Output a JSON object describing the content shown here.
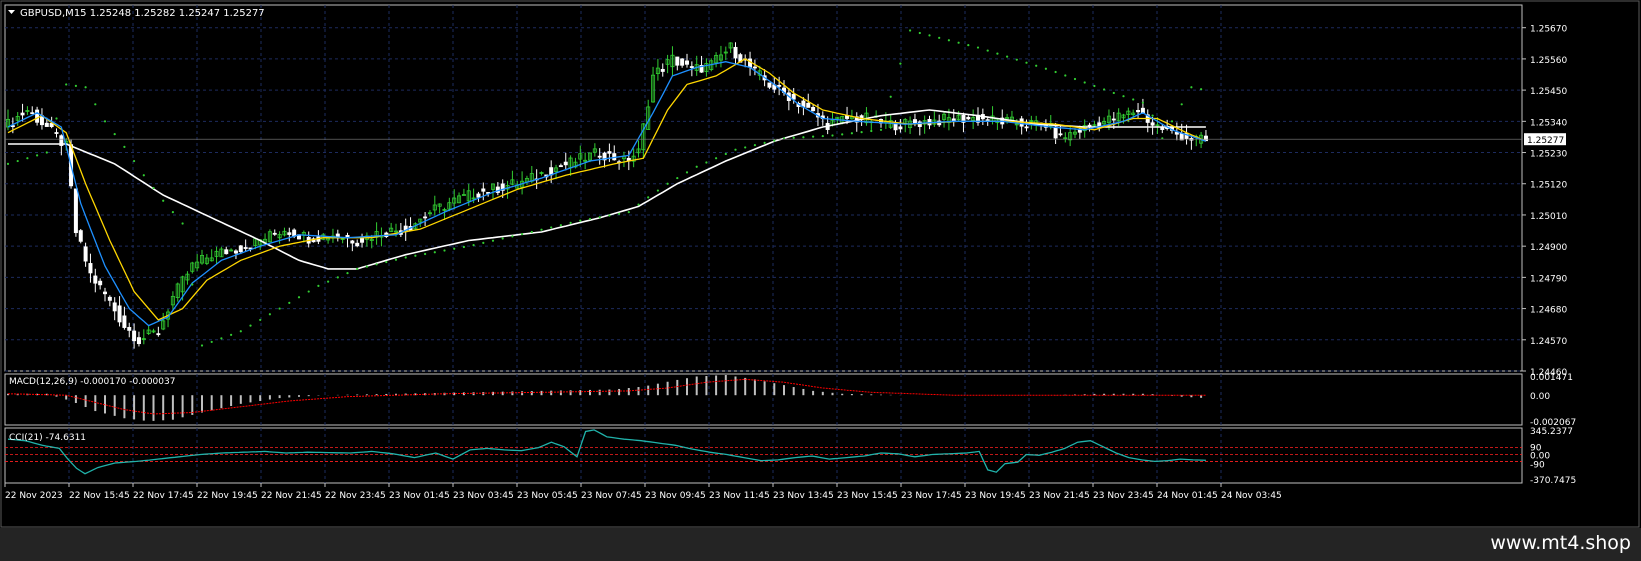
{
  "colors": {
    "background": "#000000",
    "grid": "#1d2b5e",
    "pane_border": "#c0c0c0",
    "text": "#ffffff",
    "bull_candle": "#32cd32",
    "bear_candle": "#ffffff",
    "ma_fast": "#1e90ff",
    "ma_mid": "#ffd700",
    "ma_slow": "#ffffff",
    "psar": "#32cd32",
    "macd_hist": "#c0c0c0",
    "macd_signal": "#ff0000",
    "cci_line": "#20b2aa",
    "cci_level": "#ff2020",
    "footer_bg": "#242424"
  },
  "header": {
    "symbol_info": "GBPUSD,M15  1.25248 1.25282 1.25247 1.25277"
  },
  "price_axis": {
    "ticks": [
      "1.25670",
      "1.25560",
      "1.25450",
      "1.25340",
      "1.25230",
      "1.25120",
      "1.25010",
      "1.24900",
      "1.24790",
      "1.24680",
      "1.24570",
      "1.24460"
    ],
    "current_price": "1.25277"
  },
  "macd": {
    "label": "MACD(12,26,9) -0.000170 -0.000037",
    "ticks": [
      "0.001471",
      "0.00",
      "-0.002067"
    ]
  },
  "cci": {
    "label": "CCI(21) -74.6311",
    "ticks": [
      "345.2377",
      "90",
      "0.00",
      "-90",
      "-370.7475"
    ]
  },
  "time_axis": [
    "22 Nov 2023",
    "22 Nov 15:45",
    "22 Nov 17:45",
    "22 Nov 19:45",
    "22 Nov 21:45",
    "22 Nov 23:45",
    "23 Nov 01:45",
    "23 Nov 03:45",
    "23 Nov 05:45",
    "23 Nov 07:45",
    "23 Nov 09:45",
    "23 Nov 11:45",
    "23 Nov 13:45",
    "23 Nov 15:45",
    "23 Nov 17:45",
    "23 Nov 19:45",
    "23 Nov 21:45",
    "23 Nov 23:45",
    "24 Nov 01:45",
    "24 Nov 03:45"
  ],
  "footer": {
    "url": "www.mt4.shop"
  },
  "chart_data": [
    {
      "type": "candlestick",
      "symbol": "GBPUSD",
      "timeframe": "M15",
      "ylim": [
        1.2446,
        1.2575
      ],
      "close_path": [
        [
          0,
          1.2533
        ],
        [
          4,
          1.2538
        ],
        [
          8,
          1.2532
        ],
        [
          12,
          1.2525
        ],
        [
          14,
          1.2495
        ],
        [
          17,
          1.248
        ],
        [
          20,
          1.2473
        ],
        [
          24,
          1.2462
        ],
        [
          27,
          1.2457
        ],
        [
          31,
          1.246
        ],
        [
          34,
          1.2472
        ],
        [
          38,
          1.2483
        ],
        [
          42,
          1.2487
        ],
        [
          47,
          1.2489
        ],
        [
          52,
          1.2492
        ],
        [
          57,
          1.2496
        ],
        [
          62,
          1.2493
        ],
        [
          67,
          1.2494
        ],
        [
          72,
          1.2492
        ],
        [
          77,
          1.2495
        ],
        [
          82,
          1.2496
        ],
        [
          87,
          1.2502
        ],
        [
          92,
          1.2506
        ],
        [
          97,
          1.2509
        ],
        [
          102,
          1.2511
        ],
        [
          107,
          1.2513
        ],
        [
          112,
          1.2517
        ],
        [
          117,
          1.252
        ],
        [
          122,
          1.2523
        ],
        [
          127,
          1.252
        ],
        [
          130,
          1.2523
        ],
        [
          133,
          1.255
        ],
        [
          137,
          1.2556
        ],
        [
          141,
          1.2552
        ],
        [
          145,
          1.2554
        ],
        [
          149,
          1.256
        ],
        [
          153,
          1.2553
        ],
        [
          157,
          1.2547
        ],
        [
          161,
          1.2543
        ],
        [
          165,
          1.2538
        ],
        [
          169,
          1.2533
        ],
        [
          173,
          1.2535
        ],
        [
          177,
          1.2535
        ],
        [
          181,
          1.2533
        ],
        [
          185,
          1.2533
        ],
        [
          190,
          1.2534
        ],
        [
          195,
          1.2535
        ],
        [
          200,
          1.2535
        ],
        [
          205,
          1.2534
        ],
        [
          210,
          1.2533
        ],
        [
          214,
          1.2533
        ],
        [
          217,
          1.2528
        ],
        [
          221,
          1.2531
        ],
        [
          226,
          1.2534
        ],
        [
          230,
          1.2536
        ],
        [
          233,
          1.2538
        ],
        [
          236,
          1.2533
        ],
        [
          240,
          1.253
        ],
        [
          244,
          1.2528
        ],
        [
          247,
          1.2527
        ]
      ],
      "ma_fast_path": [
        [
          0,
          1.2532
        ],
        [
          6,
          1.2537
        ],
        [
          11,
          1.2532
        ],
        [
          15,
          1.2505
        ],
        [
          20,
          1.2483
        ],
        [
          25,
          1.2468
        ],
        [
          29,
          1.2462
        ],
        [
          33,
          1.2465
        ],
        [
          38,
          1.2477
        ],
        [
          44,
          1.2485
        ],
        [
          52,
          1.249
        ],
        [
          60,
          1.2494
        ],
        [
          70,
          1.2493
        ],
        [
          80,
          1.2494
        ],
        [
          90,
          1.2502
        ],
        [
          100,
          1.2509
        ],
        [
          110,
          1.2514
        ],
        [
          120,
          1.252
        ],
        [
          128,
          1.2522
        ],
        [
          133,
          1.2537
        ],
        [
          137,
          1.255
        ],
        [
          142,
          1.2553
        ],
        [
          148,
          1.2555
        ],
        [
          153,
          1.2553
        ],
        [
          158,
          1.2547
        ],
        [
          163,
          1.254
        ],
        [
          168,
          1.2535
        ],
        [
          175,
          1.2534
        ],
        [
          185,
          1.2533
        ],
        [
          195,
          1.2534
        ],
        [
          205,
          1.2534
        ],
        [
          215,
          1.2532
        ],
        [
          222,
          1.2531
        ],
        [
          230,
          1.2534
        ],
        [
          234,
          1.2537
        ],
        [
          240,
          1.2531
        ],
        [
          247,
          1.2527
        ]
      ],
      "ma_mid_path": [
        [
          0,
          1.253
        ],
        [
          7,
          1.2536
        ],
        [
          12,
          1.253
        ],
        [
          16,
          1.2512
        ],
        [
          21,
          1.2492
        ],
        [
          26,
          1.2474
        ],
        [
          31,
          1.2464
        ],
        [
          36,
          1.2468
        ],
        [
          41,
          1.2478
        ],
        [
          48,
          1.2485
        ],
        [
          56,
          1.249
        ],
        [
          65,
          1.2493
        ],
        [
          75,
          1.2493
        ],
        [
          85,
          1.2496
        ],
        [
          95,
          1.2503
        ],
        [
          105,
          1.251
        ],
        [
          115,
          1.2515
        ],
        [
          125,
          1.2519
        ],
        [
          131,
          1.2521
        ],
        [
          136,
          1.2538
        ],
        [
          140,
          1.2547
        ],
        [
          146,
          1.255
        ],
        [
          152,
          1.2556
        ],
        [
          157,
          1.2551
        ],
        [
          162,
          1.2544
        ],
        [
          168,
          1.2538
        ],
        [
          176,
          1.2535
        ],
        [
          186,
          1.2533
        ],
        [
          196,
          1.2534
        ],
        [
          206,
          1.2534
        ],
        [
          216,
          1.2533
        ],
        [
          224,
          1.2531
        ],
        [
          232,
          1.2535
        ],
        [
          237,
          1.2535
        ],
        [
          243,
          1.253
        ],
        [
          247,
          1.2527
        ]
      ],
      "ma_slow_path": [
        [
          0,
          1.2526
        ],
        [
          12,
          1.2526
        ],
        [
          22,
          1.2519
        ],
        [
          32,
          1.2508
        ],
        [
          42,
          1.25
        ],
        [
          52,
          1.2492
        ],
        [
          60,
          1.2485
        ],
        [
          66,
          1.2482
        ],
        [
          72,
          1.2482
        ],
        [
          82,
          1.2487
        ],
        [
          95,
          1.2492
        ],
        [
          110,
          1.2495
        ],
        [
          122,
          1.25
        ],
        [
          130,
          1.2504
        ],
        [
          138,
          1.2512
        ],
        [
          148,
          1.252
        ],
        [
          158,
          1.2527
        ],
        [
          168,
          1.2532
        ],
        [
          180,
          1.2536
        ],
        [
          190,
          1.2538
        ],
        [
          200,
          1.2536
        ],
        [
          212,
          1.2533
        ],
        [
          222,
          1.2532
        ],
        [
          232,
          1.2532
        ],
        [
          247,
          1.2532
        ]
      ],
      "psar_path": [
        [
          0,
          1.2519
        ],
        [
          8,
          1.2523
        ],
        [
          12,
          1.2547
        ],
        [
          16,
          1.2546
        ],
        [
          20,
          1.2534
        ],
        [
          24,
          1.2525
        ],
        [
          28,
          1.2515
        ],
        [
          32,
          1.2506
        ],
        [
          36,
          1.2498
        ],
        [
          40,
          1.2455
        ],
        [
          48,
          1.246
        ],
        [
          56,
          1.2468
        ],
        [
          64,
          1.2476
        ],
        [
          72,
          1.2482
        ],
        [
          82,
          1.2486
        ],
        [
          95,
          1.249
        ],
        [
          108,
          1.2495
        ],
        [
          118,
          1.2499
        ],
        [
          128,
          1.2502
        ],
        [
          131,
          1.2506
        ],
        [
          136,
          1.2512
        ],
        [
          142,
          1.2518
        ],
        [
          150,
          1.2524
        ],
        [
          160,
          1.2528
        ],
        [
          170,
          1.2529
        ],
        [
          180,
          1.2531
        ],
        [
          186,
          1.2566
        ],
        [
          200,
          1.256
        ],
        [
          215,
          1.2552
        ],
        [
          228,
          1.2544
        ],
        [
          235,
          1.254
        ],
        [
          238,
          1.2528
        ],
        [
          244,
          1.2546
        ],
        [
          247,
          1.2545
        ]
      ],
      "last_price": 1.25277
    },
    {
      "type": "bar",
      "title": "MACD(12,26,9)",
      "ylim": [
        -0.002067,
        0.001471
      ],
      "hist_path": [
        [
          0,
          0.0001
        ],
        [
          8,
          0.0001
        ],
        [
          13,
          -0.0004
        ],
        [
          18,
          -0.0011
        ],
        [
          24,
          -0.0016
        ],
        [
          29,
          -0.0018
        ],
        [
          34,
          -0.0017
        ],
        [
          40,
          -0.0012
        ],
        [
          48,
          -0.0006
        ],
        [
          56,
          -0.0002
        ],
        [
          65,
          0.0
        ],
        [
          80,
          0.0001
        ],
        [
          95,
          0.0002
        ],
        [
          110,
          0.0003
        ],
        [
          125,
          0.0004
        ],
        [
          131,
          0.0006
        ],
        [
          137,
          0.001
        ],
        [
          142,
          0.0013
        ],
        [
          148,
          0.0014
        ],
        [
          154,
          0.0011
        ],
        [
          160,
          0.0007
        ],
        [
          166,
          0.0003
        ],
        [
          172,
          0.0001
        ],
        [
          185,
          0.0
        ],
        [
          200,
          0.0
        ],
        [
          215,
          0.0
        ],
        [
          225,
          0.0001
        ],
        [
          235,
          0.0001
        ],
        [
          242,
          -0.0001
        ],
        [
          247,
          -0.0002
        ]
      ],
      "signal_path": [
        [
          0,
          0.0001
        ],
        [
          12,
          0.0
        ],
        [
          18,
          -0.0005
        ],
        [
          24,
          -0.001
        ],
        [
          30,
          -0.0013
        ],
        [
          38,
          -0.0012
        ],
        [
          48,
          -0.0008
        ],
        [
          58,
          -0.0004
        ],
        [
          70,
          -0.0001
        ],
        [
          90,
          0.0001
        ],
        [
          110,
          0.0002
        ],
        [
          128,
          0.0003
        ],
        [
          136,
          0.0005
        ],
        [
          144,
          0.0009
        ],
        [
          152,
          0.0011
        ],
        [
          160,
          0.0009
        ],
        [
          168,
          0.0005
        ],
        [
          178,
          0.0002
        ],
        [
          195,
          0.0
        ],
        [
          220,
          0.0
        ],
        [
          240,
          0.0
        ],
        [
          247,
          -0.0
        ]
      ]
    },
    {
      "type": "line",
      "title": "CCI(21)",
      "ylim": [
        -370.7475,
        345.2377
      ],
      "levels": [
        90,
        0,
        -90
      ],
      "line_path": [
        [
          0,
          200
        ],
        [
          4,
          180
        ],
        [
          8,
          120
        ],
        [
          12,
          80
        ],
        [
          14,
          -60
        ],
        [
          16,
          -180
        ],
        [
          18,
          -250
        ],
        [
          21,
          -170
        ],
        [
          25,
          -110
        ],
        [
          30,
          -90
        ],
        [
          35,
          -60
        ],
        [
          40,
          -30
        ],
        [
          45,
          0
        ],
        [
          50,
          20
        ],
        [
          55,
          30
        ],
        [
          60,
          40
        ],
        [
          65,
          20
        ],
        [
          70,
          30
        ],
        [
          75,
          25
        ],
        [
          80,
          20
        ],
        [
          85,
          40
        ],
        [
          90,
          10
        ],
        [
          95,
          -40
        ],
        [
          100,
          20
        ],
        [
          104,
          -60
        ],
        [
          108,
          60
        ],
        [
          112,
          80
        ],
        [
          116,
          60
        ],
        [
          120,
          50
        ],
        [
          124,
          90
        ],
        [
          127,
          160
        ],
        [
          130,
          100
        ],
        [
          133,
          -30
        ],
        [
          135,
          300
        ],
        [
          137,
          320
        ],
        [
          140,
          230
        ],
        [
          144,
          200
        ],
        [
          148,
          180
        ],
        [
          152,
          150
        ],
        [
          156,
          120
        ],
        [
          160,
          70
        ],
        [
          164,
          30
        ],
        [
          168,
          0
        ],
        [
          172,
          -40
        ],
        [
          176,
          -80
        ],
        [
          180,
          -70
        ],
        [
          184,
          -40
        ],
        [
          188,
          -20
        ],
        [
          192,
          -60
        ],
        [
          196,
          -40
        ],
        [
          200,
          -20
        ],
        [
          204,
          20
        ],
        [
          208,
          10
        ],
        [
          212,
          -30
        ],
        [
          216,
          0
        ],
        [
          220,
          10
        ],
        [
          224,
          20
        ],
        [
          227,
          40
        ],
        [
          229,
          -200
        ],
        [
          231,
          -230
        ],
        [
          233,
          -120
        ],
        [
          236,
          -100
        ],
        [
          238,
          0
        ],
        [
          241,
          -10
        ],
        [
          244,
          30
        ],
        [
          247,
          80
        ],
        [
          250,
          160
        ],
        [
          253,
          180
        ],
        [
          256,
          100
        ],
        [
          259,
          20
        ],
        [
          262,
          -40
        ],
        [
          265,
          -70
        ],
        [
          268,
          -90
        ],
        [
          271,
          -80
        ],
        [
          274,
          -60
        ],
        [
          277,
          -70
        ],
        [
          280,
          -74.6311
        ]
      ]
    }
  ]
}
